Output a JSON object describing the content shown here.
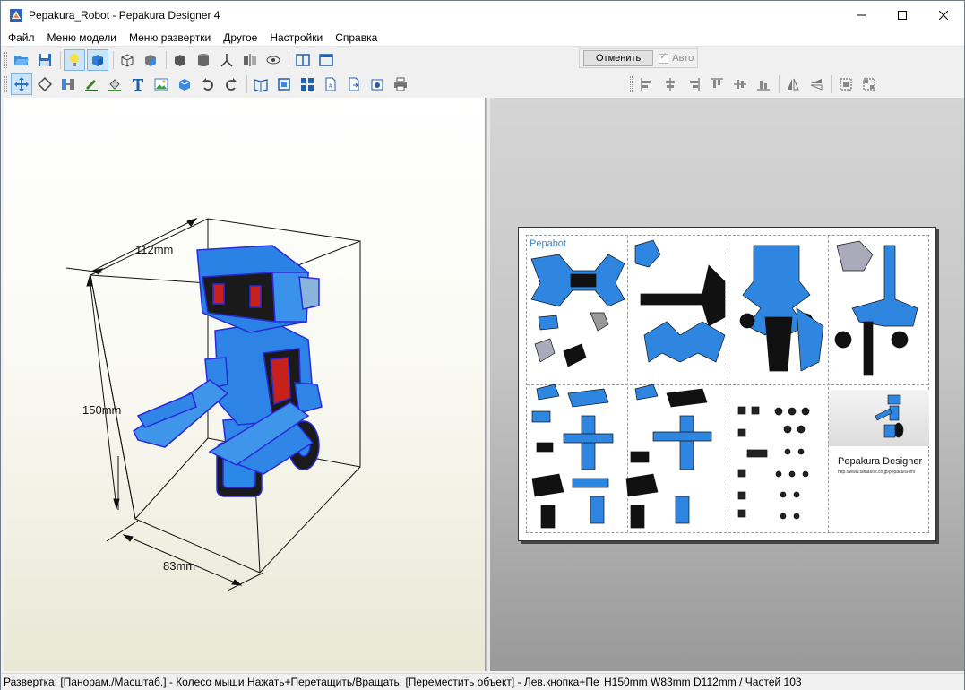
{
  "window": {
    "title": "Pepakura_Robot - Pepakura Designer 4"
  },
  "menu": [
    "Файл",
    "Меню модели",
    "Меню развертки",
    "Другое",
    "Настройки",
    "Справка"
  ],
  "undo_panel": {
    "undo_label": "Отменить",
    "auto_label": "Авто",
    "auto_checked": true
  },
  "view3d": {
    "dim_width": "112mm",
    "dim_height": "150mm",
    "dim_depth": "83mm"
  },
  "view2d": {
    "paper_title": "Pepabot",
    "paper_brand": "Pepakura Designer",
    "paper_url": "http://www.tamasoft.co.jp/pepakura-en/"
  },
  "status": {
    "hint": "Развертка: [Панорам./Масштаб.] - Колесо мыши Нажать+Перетащить/Вращать; [Переместить объект] - Лев.кнопка+Пе",
    "dims": "H150mm W83mm D112mm / Частей 103"
  },
  "colors": {
    "accent": "#2d87d6",
    "robot_blue": "#1e7fe0",
    "robot_outline": "#2a2ad8"
  }
}
